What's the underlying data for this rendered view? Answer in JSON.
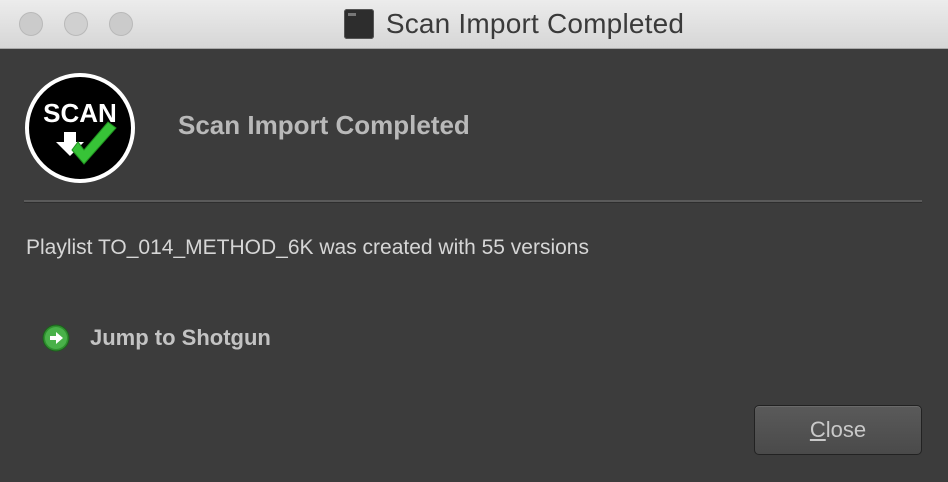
{
  "window": {
    "title": "Scan Import Completed",
    "title_icon": "app-icon"
  },
  "header": {
    "logo_text": "SCAN",
    "logo_icon": "scan-checkmark-logo",
    "title": "Scan Import Completed"
  },
  "message": "Playlist TO_014_METHOD_6K was created with 55 versions",
  "link": {
    "icon": "green-arrow-right-icon",
    "label": "Jump to Shotgun"
  },
  "buttons": {
    "close_first": "C",
    "close_rest": "lose"
  },
  "colors": {
    "background": "#3c3c3c",
    "accent_green": "#3fbf3f"
  }
}
